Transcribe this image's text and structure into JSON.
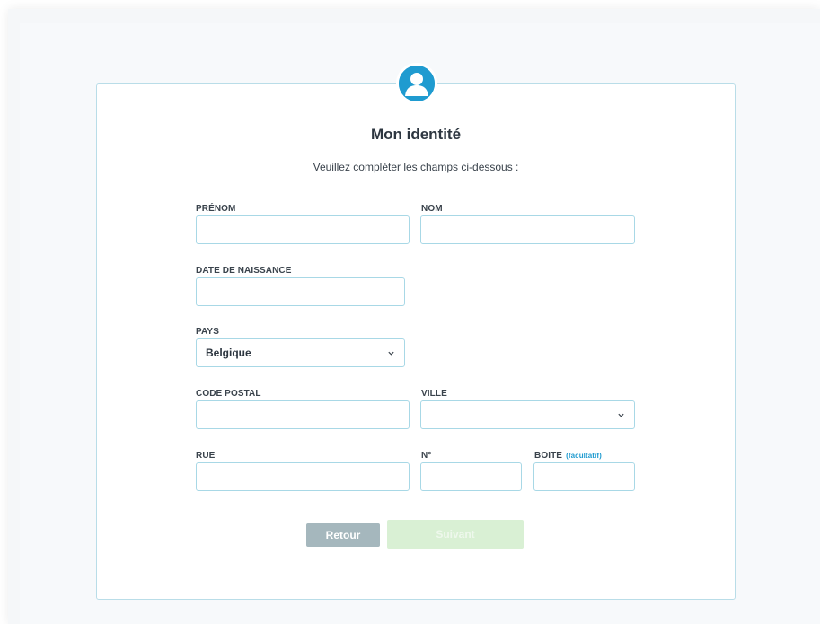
{
  "header": {
    "title": "Mon identité",
    "subtitle": "Veuillez compléter les champs ci-dessous :"
  },
  "form": {
    "prenom": {
      "label": "PRÉNOM",
      "value": ""
    },
    "nom": {
      "label": "NOM",
      "value": ""
    },
    "date_naissance": {
      "label": "DATE DE NAISSANCE",
      "value": ""
    },
    "pays": {
      "label": "PAYS",
      "selected": "Belgique"
    },
    "code_postal": {
      "label": "CODE POSTAL",
      "value": ""
    },
    "ville": {
      "label": "VILLE",
      "selected": ""
    },
    "rue": {
      "label": "RUE",
      "value": ""
    },
    "numero": {
      "label": "N°",
      "value": ""
    },
    "boite": {
      "label": "BOITE",
      "optional": "(facultatif)",
      "value": ""
    }
  },
  "buttons": {
    "back": "Retour",
    "next": "Suivant"
  },
  "icons": {
    "avatar": "user-avatar-icon",
    "dropdown": "chevron-down-icon"
  },
  "colors": {
    "accent": "#1f9bd0",
    "border": "#a8d8e6",
    "back_button": "#a5b7bd",
    "next_button_disabled": "#d9f0d4"
  }
}
